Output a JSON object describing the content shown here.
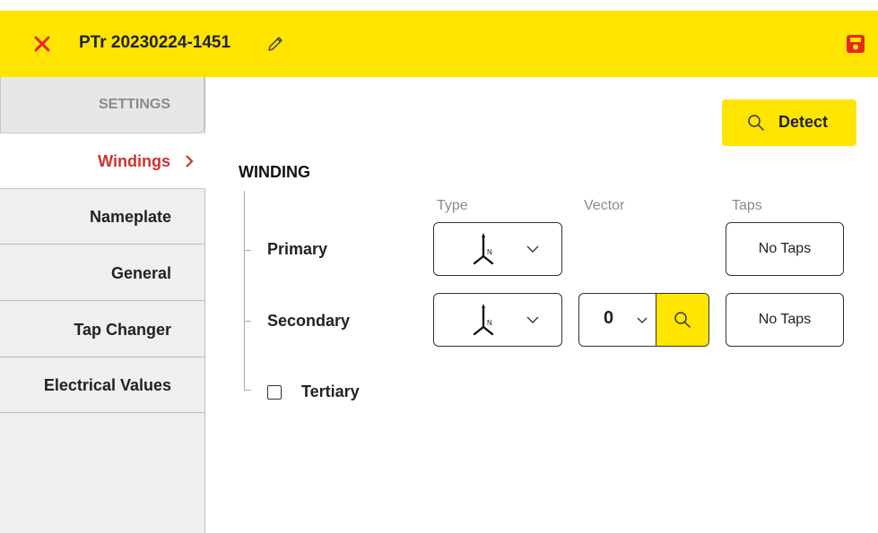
{
  "header": {
    "title": "PTr 20230224-1451"
  },
  "sidebar": {
    "items": [
      {
        "label": "SETTINGS"
      },
      {
        "label": "Windings",
        "active_suffix": ">"
      },
      {
        "label": "Nameplate"
      },
      {
        "label": "General"
      },
      {
        "label": "Tap Changer"
      },
      {
        "label": "Electrical Values"
      }
    ]
  },
  "detect": {
    "label": "Detect"
  },
  "winding": {
    "title": "WINDING",
    "columns": {
      "type": "Type",
      "vector": "Vector",
      "taps": "Taps"
    },
    "rows": [
      {
        "label": "Primary",
        "type_symbol": "N",
        "taps": "No Taps"
      },
      {
        "label": "Secondary",
        "type_symbol": "N",
        "vector": "0",
        "taps": "No Taps"
      }
    ],
    "tertiary": {
      "label": "Tertiary",
      "checked": false
    }
  },
  "colors": {
    "accent": "#ffe500",
    "active": "#d0312d"
  },
  "icons": [
    "close-icon",
    "pencil-icon",
    "save-icon",
    "search-icon",
    "star-winding-icon",
    "chevron-down-icon",
    "chevron-right-icon"
  ]
}
